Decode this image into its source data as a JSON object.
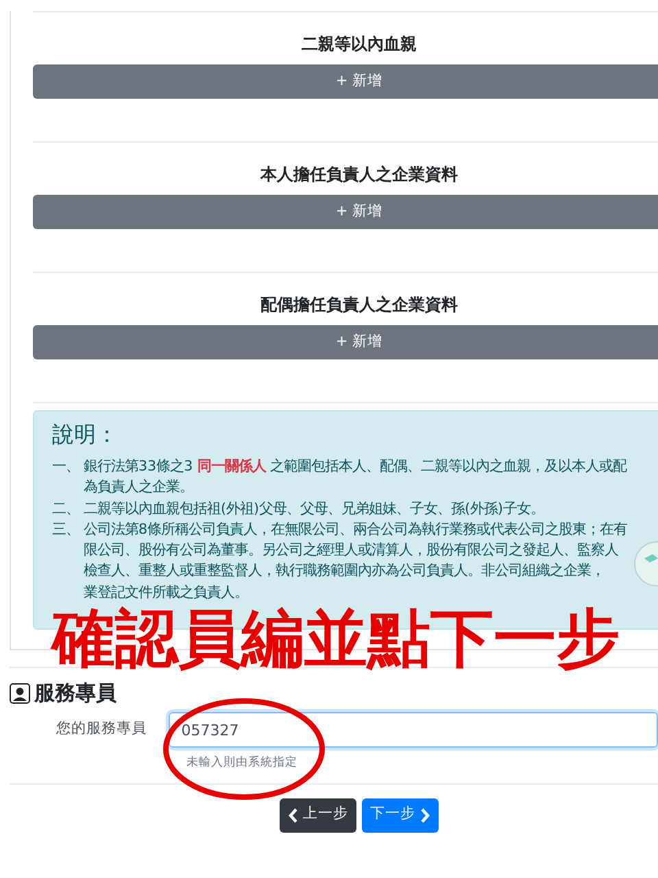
{
  "sections": [
    {
      "title": "二親等以內血親",
      "add_button": "+ 新增"
    },
    {
      "title": "本人擔任負責人之企業資料",
      "add_button": "+ 新增"
    },
    {
      "title": "配偶擔任負責人之企業資料",
      "add_button": "+ 新增"
    }
  ],
  "notes": {
    "title": "說明：",
    "items": [
      {
        "marker": "一、",
        "lines": [
          "銀行法第33條之3 **同一關係人** 之範圍包括本人、配偶、二親等以內之血親，及以本人或配",
          "為負責人之企業。"
        ]
      },
      {
        "marker": "二、",
        "lines": [
          "二親等以內血親包括祖(外祖)父母、父母、兄弟姐妹、子女、孫(外孫)子女。"
        ]
      },
      {
        "marker": "三、",
        "lines": [
          "公司法第8條所稱公司負責人，在無限公司、兩合公司為執行業務或代表公司之股東；在有",
          "限公司、股份有公司為董事。另公司之經理人或清算人，股份有限公司之發起人、監察人",
          "檢查人、重整人或重整監督人，執行職務範圍內亦為公司負責人。非公司組織之企業，",
          "業登記文件所載之負責人。"
        ]
      }
    ]
  },
  "service": {
    "title": "服務專員",
    "label": "您的服務專員",
    "value": "057327",
    "help": "未輸入則由系統指定"
  },
  "nav_buttons": [
    {
      "label": "上一步",
      "kind": "prev"
    },
    {
      "label": "下一步",
      "kind": "next"
    }
  ],
  "annotation": {
    "text": "確認員編並點下一步"
  }
}
